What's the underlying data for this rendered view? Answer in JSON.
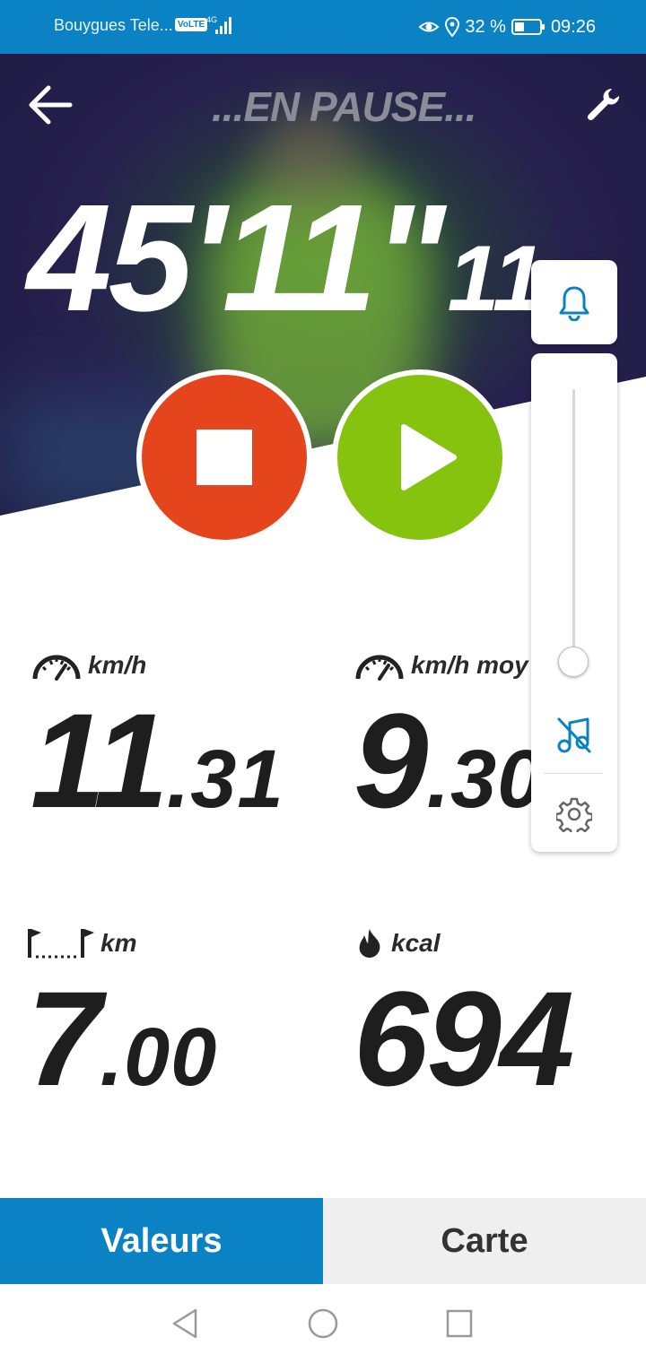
{
  "status_bar": {
    "carrier": "Bouygues Tele...",
    "volte": "VoLTE",
    "network": "4G",
    "battery": "32 %",
    "time": "09:26"
  },
  "header": {
    "status_text": "...EN PAUSE..."
  },
  "timer": {
    "main": "45'11\"",
    "hundredths": "11"
  },
  "metrics": {
    "speed": {
      "unit": "km/h",
      "int": "11",
      "dec": ".31"
    },
    "avg_speed": {
      "unit": "km/h moy",
      "int": "9",
      "dec": ".30"
    },
    "distance": {
      "unit": "km",
      "int": "7",
      "dec": ".00"
    },
    "calories": {
      "unit": "kcal",
      "int": "694",
      "dec": ""
    }
  },
  "volume": {
    "level": 0.05
  },
  "tabs": {
    "values": "Valeurs",
    "map": "Carte"
  },
  "colors": {
    "accent": "#0a82c4",
    "stop": "#e5451d",
    "play": "#86c30f"
  }
}
